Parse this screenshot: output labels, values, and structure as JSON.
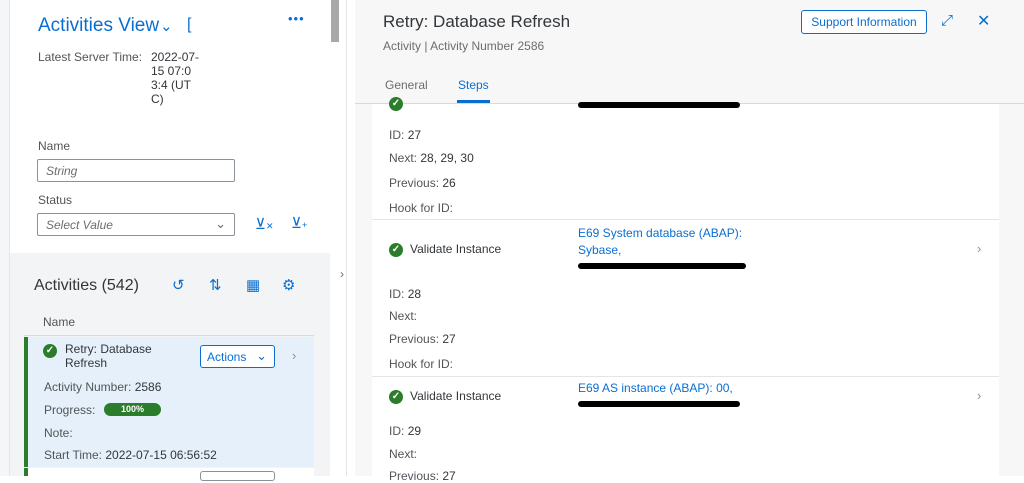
{
  "left": {
    "view_title": "Activities View",
    "view_variant": "[",
    "more_icon": "overflow-icon",
    "server_time_label": "Latest Server Time:",
    "server_time_value": "2022-07-15 07:03:4 (UTC)",
    "filters": {
      "name_label": "Name",
      "name_placeholder": "String",
      "status_label": "Status",
      "status_placeholder": "Select Value"
    },
    "list": {
      "title": "Activities (542)",
      "column_name": "Name",
      "selected_row": {
        "title": "Retry: Database Refresh",
        "actions_label": "Actions",
        "activity_number_label": "Activity Number:",
        "activity_number": "2586",
        "progress_label": "Progress:",
        "progress_value": "100%",
        "progress_fraction": 1.0,
        "note_label": "Note:",
        "start_time_label": "Start Time:",
        "start_time": "2022-07-15 06:56:52"
      }
    }
  },
  "object": {
    "title": "Retry: Database Refresh",
    "subtitle": "Activity | Activity Number 2586",
    "support_button": "Support Information",
    "tabs": [
      {
        "label": "General",
        "active": false
      },
      {
        "label": "Steps",
        "active": true
      }
    ]
  },
  "steps": [
    {
      "name": "",
      "target": "",
      "id_label": "ID:",
      "id": "27",
      "next_label": "Next:",
      "next": "28, 29, 30",
      "previous_label": "Previous:",
      "previous": "26",
      "hook_label": "Hook for ID:",
      "hook": ""
    },
    {
      "name": "Validate Instance",
      "target": "E69 System database (ABAP): Sybase,",
      "id_label": "ID:",
      "id": "28",
      "next_label": "Next:",
      "next": "",
      "previous_label": "Previous:",
      "previous": "27",
      "hook_label": "Hook for ID:",
      "hook": ""
    },
    {
      "name": "Validate Instance",
      "target": "E69 AS instance (ABAP): 00,",
      "id_label": "ID:",
      "id": "29",
      "next_label": "Next:",
      "next": "",
      "previous_label": "Previous:",
      "previous": "27"
    }
  ],
  "colors": {
    "accent": "#0a6ed1",
    "success": "#2b7d2b",
    "selected_row_bg": "#e5f0fa"
  }
}
